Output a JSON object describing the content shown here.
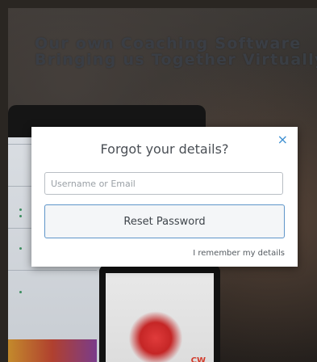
{
  "hero": {
    "line1": "Our own Coaching Software",
    "line2": "Bringing us Together Virtually"
  },
  "modal": {
    "title": "Forgot your details?",
    "close_icon": "×",
    "username_placeholder": "Username or Email",
    "username_value": "",
    "reset_button_label": "Reset Password",
    "remember_link": "I remember my details"
  },
  "colors": {
    "accent": "#3d8fd1",
    "button_border": "#5f95c9",
    "overlay": "#2a2622"
  },
  "icons": {
    "close": "close-icon"
  }
}
